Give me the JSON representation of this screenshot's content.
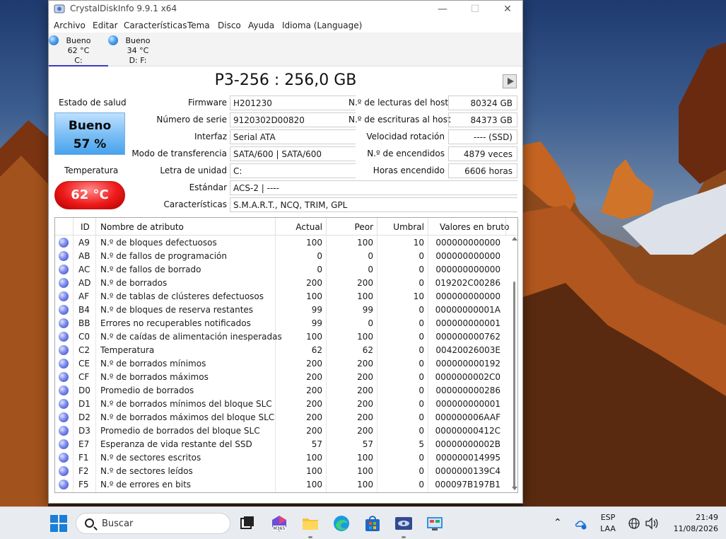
{
  "window": {
    "title": "CrystalDiskInfo 9.9.1 x64",
    "menu": [
      "Archivo",
      "Editar",
      "Características",
      "Tema",
      "Disco",
      "Ayuda",
      "Idioma (Language)"
    ]
  },
  "disks": [
    {
      "status": "Bueno",
      "temp": "62 °C",
      "letter": "C:"
    },
    {
      "status": "Bueno",
      "temp": "34 °C",
      "letter": "D: F:"
    }
  ],
  "drive": {
    "model": "P3-256 : 256,0 GB",
    "health_label": "Estado de salud",
    "health_status": "Bueno",
    "health_percent": "57 %",
    "temp_label": "Temperatura",
    "temp_value": "62 °C",
    "labels": {
      "firmware": "Firmware",
      "serial": "Número de serie",
      "interface": "Interfaz",
      "transfer": "Modo de transferencia",
      "drive_letter": "Letra de unidad",
      "standard": "Estándar",
      "features": "Características",
      "host_reads": "N.º de lecturas del host",
      "host_writes": "N.º de escrituras al host",
      "rotation": "Velocidad rotación",
      "power_count": "N.º de encendidos",
      "power_hours": "Horas encendido"
    },
    "values": {
      "firmware": "H201230",
      "serial": "9120302D00820",
      "interface": "Serial ATA",
      "transfer": "SATA/600 | SATA/600",
      "drive_letter": "C:",
      "standard": "ACS-2 | ----",
      "features": "S.M.A.R.T., NCQ, TRIM, GPL",
      "host_reads": "80324 GB",
      "host_writes": "84373 GB",
      "rotation": "---- (SSD)",
      "power_count": "4879 veces",
      "power_hours": "6606 horas"
    }
  },
  "smart": {
    "headers": {
      "id": "ID",
      "name": "Nombre de atributo",
      "current": "Actual",
      "worst": "Peor",
      "threshold": "Umbral",
      "raw": "Valores en bruto"
    },
    "rows": [
      {
        "id": "A9",
        "name": "N.º de bloques defectuosos",
        "current": "100",
        "worst": "100",
        "threshold": "10",
        "raw": "000000000000"
      },
      {
        "id": "AB",
        "name": "N.º de fallos de programación",
        "current": "0",
        "worst": "0",
        "threshold": "0",
        "raw": "000000000000"
      },
      {
        "id": "AC",
        "name": "N.º de fallos de borrado",
        "current": "0",
        "worst": "0",
        "threshold": "0",
        "raw": "000000000000"
      },
      {
        "id": "AD",
        "name": "N.º de borrados",
        "current": "200",
        "worst": "200",
        "threshold": "0",
        "raw": "019202C00286"
      },
      {
        "id": "AF",
        "name": "N.º de tablas de clústeres defectuosos",
        "current": "100",
        "worst": "100",
        "threshold": "10",
        "raw": "000000000000"
      },
      {
        "id": "B4",
        "name": "N.º de bloques de reserva restantes",
        "current": "99",
        "worst": "99",
        "threshold": "0",
        "raw": "00000000001A"
      },
      {
        "id": "BB",
        "name": "Errores no recuperables notificados",
        "current": "99",
        "worst": "0",
        "threshold": "0",
        "raw": "000000000001"
      },
      {
        "id": "C0",
        "name": "N.º de caídas de alimentación inesperadas",
        "current": "100",
        "worst": "100",
        "threshold": "0",
        "raw": "000000000762"
      },
      {
        "id": "C2",
        "name": "Temperatura",
        "current": "62",
        "worst": "62",
        "threshold": "0",
        "raw": "00420026003E"
      },
      {
        "id": "CE",
        "name": "N.º de borrados mínimos",
        "current": "200",
        "worst": "200",
        "threshold": "0",
        "raw": "000000000192"
      },
      {
        "id": "CF",
        "name": "N.º de borrados máximos",
        "current": "200",
        "worst": "200",
        "threshold": "0",
        "raw": "0000000002C0"
      },
      {
        "id": "D0",
        "name": "Promedio de borrados",
        "current": "200",
        "worst": "200",
        "threshold": "0",
        "raw": "000000000286"
      },
      {
        "id": "D1",
        "name": "N.º de borrados mínimos del bloque SLC",
        "current": "200",
        "worst": "200",
        "threshold": "0",
        "raw": "000000000001"
      },
      {
        "id": "D2",
        "name": "N.º de borrados máximos del bloque SLC",
        "current": "200",
        "worst": "200",
        "threshold": "0",
        "raw": "000000006AAF"
      },
      {
        "id": "D3",
        "name": "Promedio de borrados del bloque SLC",
        "current": "200",
        "worst": "200",
        "threshold": "0",
        "raw": "00000000412C"
      },
      {
        "id": "E7",
        "name": "Esperanza de vida restante del SSD",
        "current": "57",
        "worst": "57",
        "threshold": "5",
        "raw": "00000000002B"
      },
      {
        "id": "F1",
        "name": "N.º de sectores escritos",
        "current": "100",
        "worst": "100",
        "threshold": "0",
        "raw": "000000014995"
      },
      {
        "id": "F2",
        "name": "N.º de sectores leídos",
        "current": "100",
        "worst": "100",
        "threshold": "0",
        "raw": "0000000139C4"
      },
      {
        "id": "F5",
        "name": "N.º de errores en bits",
        "current": "100",
        "worst": "100",
        "threshold": "0",
        "raw": "000097B197B1"
      }
    ]
  },
  "taskbar": {
    "search_placeholder": "Buscar",
    "lang_top": "ESP",
    "lang_bottom": "LAA",
    "time": "21:49",
    "date": "11/08/2026",
    "apps": [
      "start-icon",
      "task-view-icon",
      "m365-icon",
      "file-explorer-icon",
      "edge-icon",
      "store-icon",
      "crystaldiskinfo-icon",
      "control-panel-icon"
    ]
  },
  "colors": {
    "health_good": "#48a2ec",
    "temp_hot": "#ee1b1b",
    "selected_tab": "#3c3cc0"
  }
}
